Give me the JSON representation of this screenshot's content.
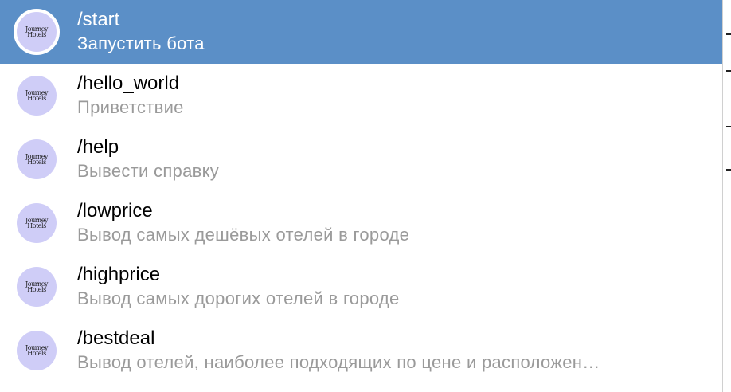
{
  "commands": [
    {
      "name": "/start",
      "description": "Запустить бота",
      "selected": true
    },
    {
      "name": "/hello_world",
      "description": "Приветствие",
      "selected": false
    },
    {
      "name": "/help",
      "description": "Вывести справку",
      "selected": false
    },
    {
      "name": "/lowprice",
      "description": "Вывод самых дешёвых отелей в городе",
      "selected": false
    },
    {
      "name": "/highprice",
      "description": "Вывод самых дорогих отелей в городе",
      "selected": false
    },
    {
      "name": "/bestdeal",
      "description": "Вывод отелей, наиболее подходящих по цене и расположен…",
      "selected": false
    }
  ],
  "bot_avatar": {
    "text": "Journey Hotels",
    "color": "#cfcdf7"
  },
  "colors": {
    "selected_background": "#5b8fc7",
    "description_text": "#9a9a9a"
  }
}
